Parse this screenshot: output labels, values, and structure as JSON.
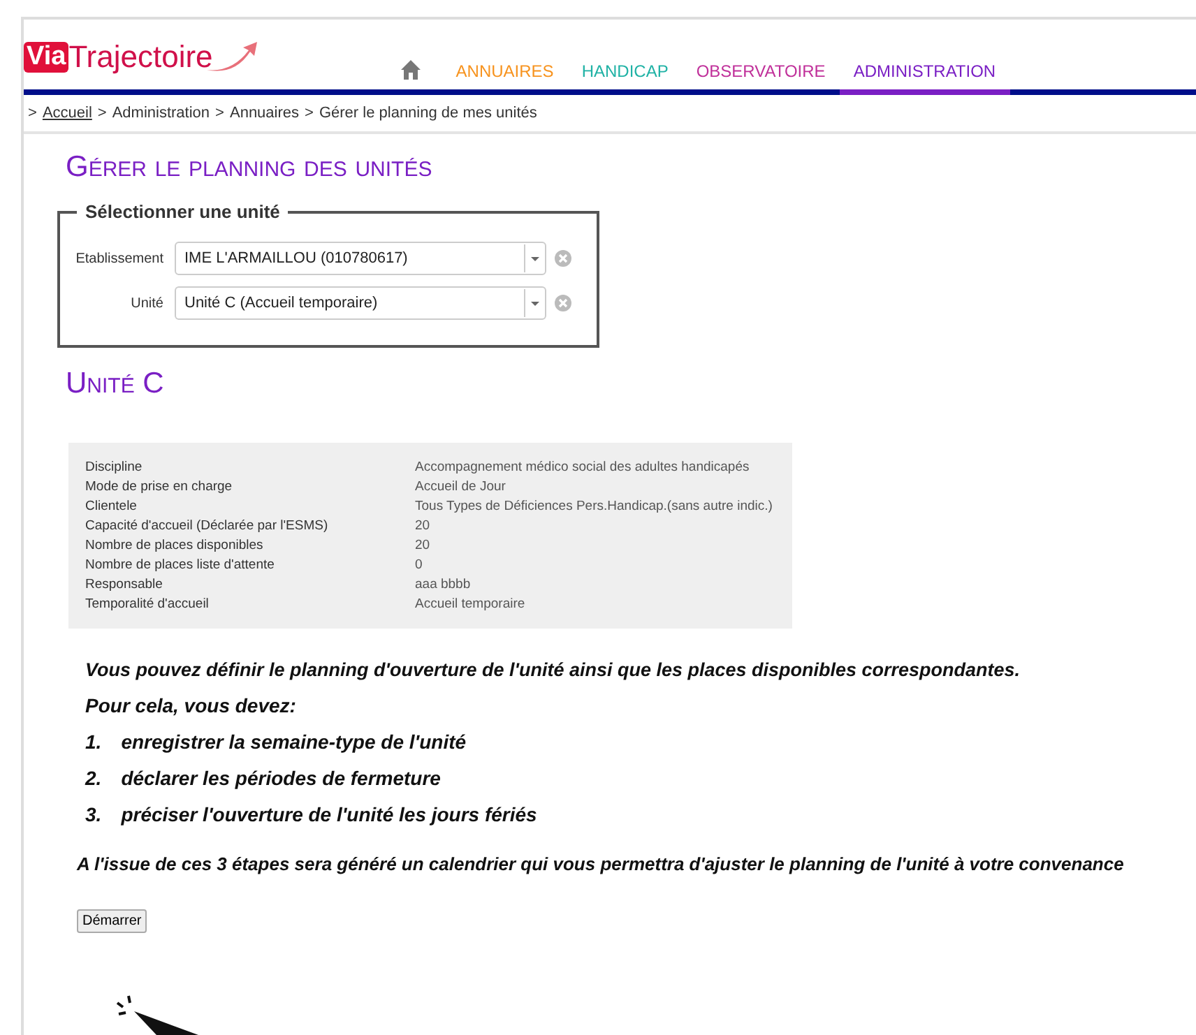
{
  "logo": {
    "part_1": "Via",
    "part_2": "Trajectoire"
  },
  "nav": [
    {
      "label": "ANNUAIRES",
      "color": "#f7931e",
      "selected": false
    },
    {
      "label": "HANDICAP",
      "color": "#20b2a5",
      "selected": false
    },
    {
      "label": "OBSERVATOIRE",
      "color": "#c0309a",
      "selected": false
    },
    {
      "label": "ADMINISTRATION",
      "color": "#7a1fc4",
      "selected": true
    }
  ],
  "breadcrumb": [
    {
      "separator": ">",
      "label": "Accueil",
      "link": true
    },
    {
      "separator": ">",
      "label": "Administration",
      "link": false
    },
    {
      "separator": ">",
      "label": "Annuaires",
      "link": false
    },
    {
      "separator": ">",
      "label": "Gérer le planning de mes unités",
      "link": false
    }
  ],
  "page_title": "Gérer le planning des unités",
  "selector": {
    "legend": "Sélectionner une unité",
    "fields": [
      {
        "label": "Etablissement",
        "value": "IME L'ARMAILLOU (010780617)"
      },
      {
        "label": "Unité",
        "value": "Unité C (Accueil temporaire)"
      }
    ]
  },
  "unit_title": "Unité C",
  "details": [
    {
      "label": "Discipline",
      "value": "Accompagnement médico social des adultes handicapés"
    },
    {
      "label": "Mode de prise en charge",
      "value": "Accueil de Jour"
    },
    {
      "label": "Clientele",
      "value": "Tous Types de Déficiences Pers.Handicap.(sans autre indic.)"
    },
    {
      "label": "Capacité d'accueil (Déclarée par l'ESMS)",
      "value": "20"
    },
    {
      "label": "Nombre de places disponibles",
      "value": "20"
    },
    {
      "label": "Nombre de places liste d'attente",
      "value": "0"
    },
    {
      "label": "Responsable",
      "value": "aaa bbbb"
    },
    {
      "label": "Temporalité d'accueil",
      "value": "Accueil temporaire"
    }
  ],
  "intro": [
    "Vous pouvez définir le planning d'ouverture de l'unité ainsi que les places disponibles correspondantes.",
    "Pour cela, vous devez:"
  ],
  "steps": [
    {
      "number": "1.",
      "text": "enregistrer la semaine-type de l'unité"
    },
    {
      "number": "2.",
      "text": "déclarer les périodes de fermeture"
    },
    {
      "number": "3.",
      "text": "préciser l'ouverture de l'unité les jours fériés"
    }
  ],
  "outro": "A l'issue de ces 3 étapes sera généré un calendrier qui vous permettra d'ajuster le planning de l'unité à votre convenance",
  "start_button": "Démarrer"
}
